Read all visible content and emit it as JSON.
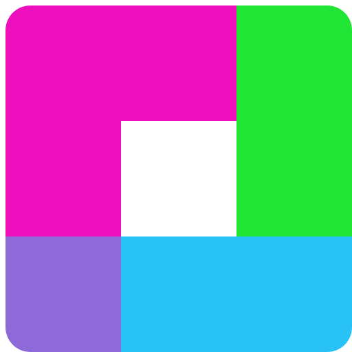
{
  "icon": {
    "name": "four-block-app-icon",
    "colors": {
      "magenta_block": "#EF10BD",
      "green_block": "#21E535",
      "center_cutout": "#FFFFFF",
      "purple_block": "#8E6AD8",
      "cyan_block": "#29C2F6"
    }
  }
}
